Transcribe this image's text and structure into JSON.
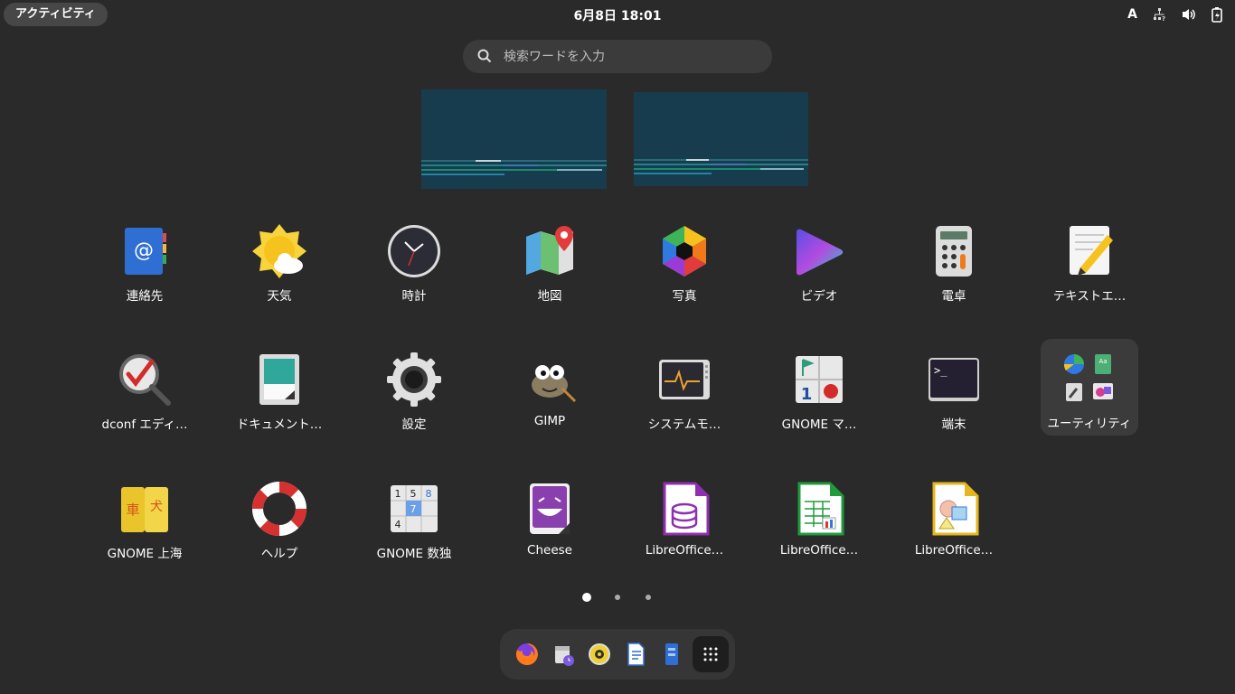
{
  "topbar": {
    "activities": "アクティビティ",
    "clock": "6月8日  18:01",
    "input_indicator": "A"
  },
  "search": {
    "placeholder": "検索ワードを入力"
  },
  "apps": [
    {
      "label": "連絡先",
      "icon": "contacts-icon"
    },
    {
      "label": "天気",
      "icon": "weather-icon"
    },
    {
      "label": "時計",
      "icon": "clock-icon"
    },
    {
      "label": "地図",
      "icon": "maps-icon"
    },
    {
      "label": "写真",
      "icon": "photos-icon"
    },
    {
      "label": "ビデオ",
      "icon": "videos-icon"
    },
    {
      "label": "電卓",
      "icon": "calculator-icon"
    },
    {
      "label": "テキストエ…",
      "icon": "text-editor-icon"
    },
    {
      "label": "dconf エディ…",
      "icon": "dconf-editor-icon"
    },
    {
      "label": "ドキュメント…",
      "icon": "document-scanner-icon"
    },
    {
      "label": "設定",
      "icon": "settings-icon"
    },
    {
      "label": "GIMP",
      "icon": "gimp-icon"
    },
    {
      "label": "システムモ…",
      "icon": "system-monitor-icon"
    },
    {
      "label": "GNOME マ…",
      "icon": "mines-icon"
    },
    {
      "label": "端末",
      "icon": "terminal-icon"
    },
    {
      "label": "ユーティリティ",
      "icon": "utilities-folder-icon"
    },
    {
      "label": "GNOME 上海",
      "icon": "mahjongg-icon"
    },
    {
      "label": "ヘルプ",
      "icon": "help-icon"
    },
    {
      "label": "GNOME 数独",
      "icon": "sudoku-icon"
    },
    {
      "label": "Cheese",
      "icon": "cheese-icon"
    },
    {
      "label": "LibreOffice…",
      "icon": "libreoffice-base-icon"
    },
    {
      "label": "LibreOffice…",
      "icon": "libreoffice-calc-icon"
    },
    {
      "label": "LibreOffice…",
      "icon": "libreoffice-draw-icon"
    }
  ],
  "pager": {
    "pages": 3,
    "current": 1
  },
  "dash": [
    "firefox-icon",
    "calendar-icon",
    "rhythmbox-icon",
    "writer-icon",
    "file-manager-icon",
    "show-apps-icon"
  ]
}
